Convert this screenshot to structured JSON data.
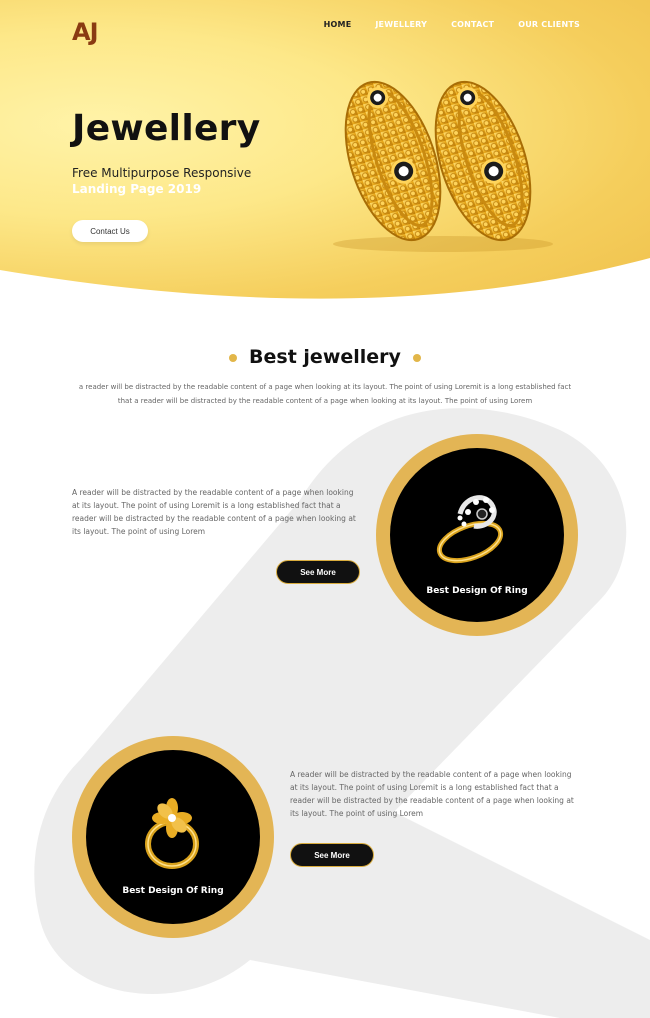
{
  "header": {
    "logo": "AJ",
    "nav": [
      "HOME",
      "JEWELLERY",
      "CONTACT",
      "OUR CLIENTS"
    ]
  },
  "hero": {
    "title": "Jewellery",
    "subtitle_line1": "Free Multipurpose Responsive",
    "subtitle_line2": "Landing Page 2019",
    "cta": "Contact Us",
    "image_icon": "gold-bangles-icon"
  },
  "section": {
    "title": "Best jewellery",
    "desc_line1": "a reader will be distracted by the readable content of a page when looking at its layout. The point of using Loremit is a long established fact",
    "desc_line2": "that a reader will be distracted by the readable content of a page when looking at its layout. The point of using Lorem"
  },
  "features": [
    {
      "text_line1": "A reader will be distracted by the readable content of a page when looking",
      "text_line2": "at its layout. The point of using Loremit is a long established fact that a",
      "text_line3": "reader will be distracted by the readable content of a page when looking at",
      "text_line4": "its layout. The point of using Lorem",
      "button": "See More",
      "caption": "Best Design Of Ring",
      "image_icon": "diamond-ring-icon"
    },
    {
      "text_line1": "A reader will be distracted by the readable content of a page when looking",
      "text_line2": "at its layout. The point of using Loremit is a long established fact that a",
      "text_line3": "reader will be distracted by the readable content of a page when looking at",
      "text_line4": "its layout. The point of using Lorem",
      "button": "See More",
      "caption": "Best Design Of Ring",
      "image_icon": "flower-ring-icon"
    }
  ],
  "colors": {
    "gold": "#e3b555",
    "hero_yellow": "#fde889",
    "dark": "#111111",
    "band_gray": "#ebebeb"
  }
}
